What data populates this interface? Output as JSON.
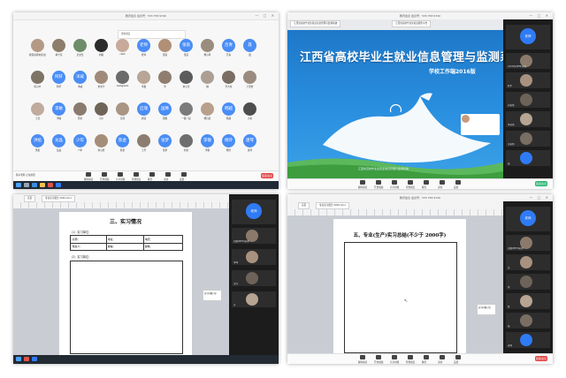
{
  "meeting": {
    "title": "腾讯会议 会议号：533 758 9740",
    "end_label": "结束会议",
    "toolbar": [
      "解除静音",
      "开启视频",
      "共享屏幕",
      "管理成员",
      "聊天",
      "录制",
      "设置"
    ]
  },
  "q1": {
    "participants": [
      {
        "name": "鲍瑞涛机电专业班",
        "initials": "",
        "color": "#b39a86"
      },
      {
        "name": "静宁花",
        "initials": "",
        "color": "#8d7d6b"
      },
      {
        "name": "吴文浩",
        "initials": "",
        "color": "#6f8c6a"
      },
      {
        "name": "刘聪",
        "initials": "",
        "color": "#2b2b2b"
      },
      {
        "name": "cabb",
        "initials": "",
        "color": "#c7aa9a"
      },
      {
        "name": "老师",
        "initials": "老师",
        "color": "#4a8df5"
      },
      {
        "name": "张丽",
        "initials": "",
        "color": "#b09075"
      },
      {
        "name": "张茵",
        "initials": "张茵",
        "color": "#4a8df5"
      },
      {
        "name": "杨小风",
        "initials": "",
        "color": "#9b8d7e"
      },
      {
        "name": "吕青",
        "initials": "吕青",
        "color": "#4a8df5"
      },
      {
        "name": "聂",
        "initials": "聂",
        "color": "#4a8df5"
      },
      {
        "name": "陈小叶",
        "initials": "",
        "color": "#7e7466"
      },
      {
        "name": "阿轩",
        "initials": "阿轩",
        "color": "#4a8df5"
      },
      {
        "name": "洋威",
        "initials": "洋威",
        "color": "#4a8df5"
      },
      {
        "name": "刘文宇",
        "initials": "",
        "color": "#a08a7a"
      },
      {
        "name": "GlobgGlob",
        "initials": "",
        "color": "#6b6b6b"
      },
      {
        "name": "李鑫",
        "initials": "",
        "color": "#b8a596"
      },
      {
        "name": "李",
        "initials": "",
        "color": "#8f7e70"
      },
      {
        "name": "刘小宝",
        "initials": "",
        "color": "#5c5c5c"
      },
      {
        "name": "魏",
        "initials": "",
        "color": "#ad9f93"
      },
      {
        "name": "李大米",
        "initials": "",
        "color": "#7a6d61"
      },
      {
        "name": "王佳怡",
        "initials": "",
        "color": "#9a8b7e"
      },
      {
        "name": "王浩",
        "initials": "",
        "color": "#c0ab9c"
      },
      {
        "name": "李敏",
        "initials": "李敏",
        "color": "#4a8df5"
      },
      {
        "name": "周文",
        "initials": "",
        "color": "#8a7b6e"
      },
      {
        "name": "小小",
        "initials": "",
        "color": "#6e6458"
      },
      {
        "name": "吴佳",
        "initials": "",
        "color": "#aa9583"
      },
      {
        "name": "启瑞",
        "initials": "启瑞",
        "color": "#4a8df5"
      },
      {
        "name": "国菁",
        "initials": "国菁",
        "color": "#4a8df5"
      },
      {
        "name": "一路一起",
        "initials": "",
        "color": "#7b7b7b"
      },
      {
        "name": "杨诗晨",
        "initials": "",
        "color": "#b8a08c"
      },
      {
        "name": "韩越",
        "initials": "韩越",
        "color": "#4a8df5"
      },
      {
        "name": "小米",
        "initials": "",
        "color": "#4e4e4e"
      },
      {
        "name": "洪焰",
        "initials": "洪焰",
        "color": "#4a8df5"
      },
      {
        "name": "龙晶",
        "initials": "龙晶",
        "color": "#4a8df5"
      },
      {
        "name": "少年",
        "initials": "少年",
        "color": "#4a8df5"
      },
      {
        "name": "刘心怡",
        "initials": "",
        "color": "#a48d79"
      },
      {
        "name": "陈金",
        "initials": "陈金",
        "color": "#4a8df5"
      },
      {
        "name": "王芳",
        "initials": "",
        "color": "#8c7d70"
      },
      {
        "name": "张梦",
        "initials": "张梦",
        "color": "#4a8df5"
      },
      {
        "name": "刘涛",
        "initials": "",
        "color": "#6e6e6e"
      },
      {
        "name": "李敬",
        "initials": "李敬",
        "color": "#4a8df5"
      },
      {
        "name": "杨玲",
        "initials": "杨玲",
        "color": "#4a8df5"
      },
      {
        "name": "唐琴",
        "initials": "唐琴",
        "color": "#4a8df5"
      }
    ],
    "status_text": "陈平老师 正在讲话"
  },
  "q2": {
    "slide_title": "江西省高校毕业生就业信息管理与监测系统",
    "slide_subtitle": "学校工作端2016版",
    "footer_text": "江西省高校毕业生就业信息管理与监测系统",
    "tabs": [
      "江西省高校毕业生就业信息管理与监测系统",
      "江西省高校毕业生就业服务平台"
    ],
    "self_tile": "老师",
    "tiles": [
      "CATHA(MFM)老师",
      "陈平",
      "刘老师",
      "李老师",
      "王老师",
      "张"
    ]
  },
  "q3": {
    "doc_tabs": [
      "首页",
      "专业实习报告 2020.docx"
    ],
    "heading": "三、实习情况",
    "section1": "（1）实习单位：",
    "table_labels": [
      "名称：",
      "地址：",
      "电话：",
      "联系人：",
      "邮编：",
      "邮箱："
    ],
    "section2": "（2）实习岗位：",
    "self_tile": "老师",
    "chat_text": "实习问题讨论",
    "tiles": [
      "刘静(MFM)老师",
      "李坤",
      "王洋",
      "许"
    ]
  },
  "q4": {
    "doc_tabs": [
      "首页",
      "专业实习报告 2020.docx"
    ],
    "heading": "五、专业(生产)实习总结(不少于 2000字)",
    "self_tile": "老师",
    "chat_text": "实习问题讨论",
    "tiles": [
      "刘静(MFM)老师",
      "王",
      "李",
      "陈",
      "张",
      "老师"
    ]
  }
}
